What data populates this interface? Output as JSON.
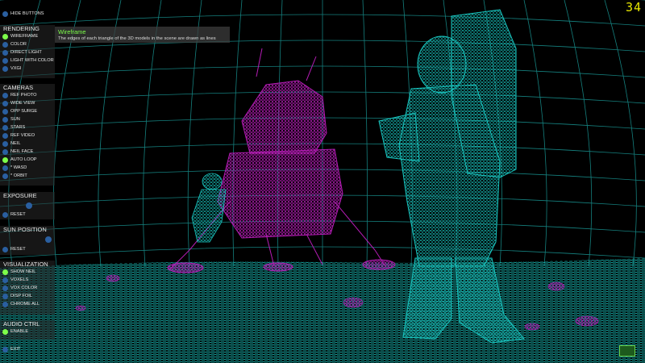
{
  "fps": "34",
  "hide_buttons": "HIDE BUTTONS",
  "tooltip": {
    "title": "Wireframe",
    "body": "The edges of each triangle of the 3D models in the scene are drawn as lines"
  },
  "rendering": {
    "header": "RENDERING",
    "items": [
      {
        "label": "WIREFRAME",
        "active": true
      },
      {
        "label": "COLOR",
        "active": false
      },
      {
        "label": "DIRECT LIGHT",
        "active": false
      },
      {
        "label": "LIGHT WITH COLOR",
        "active": false
      },
      {
        "label": "VXGI",
        "active": false
      }
    ]
  },
  "cameras": {
    "header": "CAMERAS",
    "items": [
      {
        "label": "REF PHOTO",
        "active": false
      },
      {
        "label": "WIDE VIEW",
        "active": false
      },
      {
        "label": "OPP SURGE",
        "active": false
      },
      {
        "label": "SUN",
        "active": false
      },
      {
        "label": "STARS",
        "active": false
      },
      {
        "label": "REF VIDEO",
        "active": false
      },
      {
        "label": "NEIL",
        "active": false
      },
      {
        "label": "NEIL FACE",
        "active": false
      },
      {
        "label": "AUTO LOOP",
        "active": true
      },
      {
        "label": "* WASD",
        "active": false
      },
      {
        "label": "* ORBIT",
        "active": false
      }
    ]
  },
  "exposure": {
    "header": "EXPOSURE",
    "reset": "RESET"
  },
  "sun_position": {
    "header": "SUN POSITION",
    "reset": "RESET"
  },
  "visualization": {
    "header": "VISUALIZATION",
    "items": [
      {
        "label": "SHOW NEIL",
        "active": true
      },
      {
        "label": "VOXELS",
        "active": false
      },
      {
        "label": "VOX COLOR",
        "active": false
      },
      {
        "label": "DISP FOIL",
        "active": false
      },
      {
        "label": "CHROME ALL",
        "active": false
      }
    ]
  },
  "audio": {
    "header": "AUDIO CTRL",
    "items": [
      {
        "label": "ENABLE",
        "active": true
      }
    ]
  },
  "exit": "EXIT",
  "colors": {
    "wire_cyan": "#19c6c0",
    "wire_magenta": "#b41cb4",
    "accent_green": "#7dff4a",
    "button_blue": "#2a5fa0",
    "fps_yellow": "#e6e600"
  }
}
